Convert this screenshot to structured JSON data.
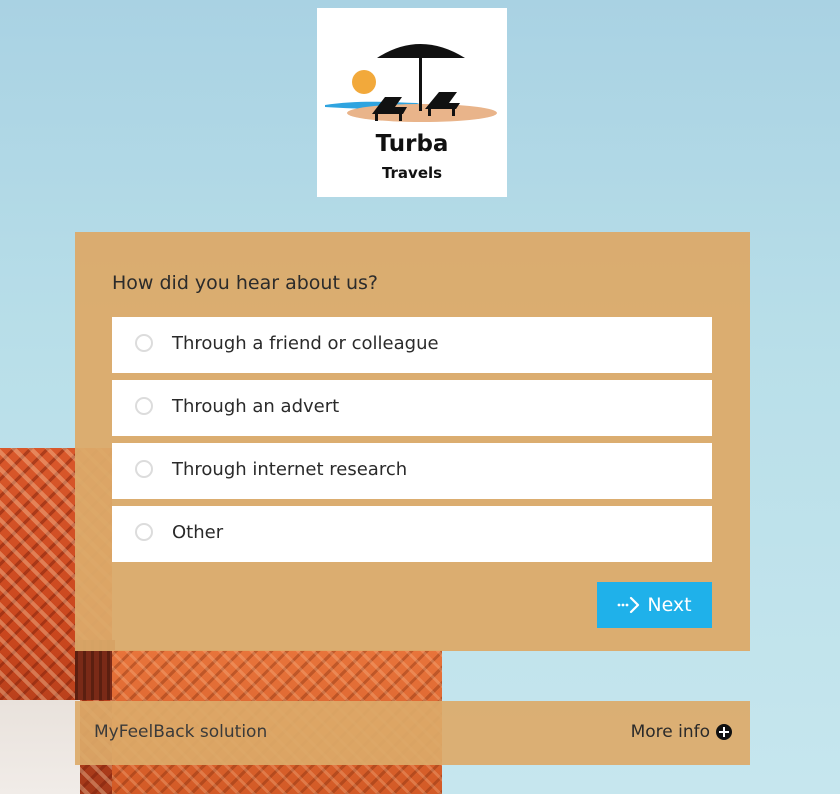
{
  "logo": {
    "title": "Turba",
    "subtitle": "Travels"
  },
  "survey": {
    "question": "How did you hear about us?",
    "options": [
      {
        "label": "Through a friend or colleague"
      },
      {
        "label": "Through an advert"
      },
      {
        "label": "Through internet research"
      },
      {
        "label": "Other"
      }
    ],
    "next_label": "Next"
  },
  "footer": {
    "solution_text": "MyFeelBack solution",
    "more_info_label": "More info"
  },
  "colors": {
    "card_background": "#dcaa69",
    "next_button": "#1fb1ea",
    "sky": "#b9dfe9"
  },
  "icons": {
    "next": "dotted-arrow-right-icon",
    "more_info": "plus-circle-icon",
    "radio": "radio-unchecked-icon"
  }
}
